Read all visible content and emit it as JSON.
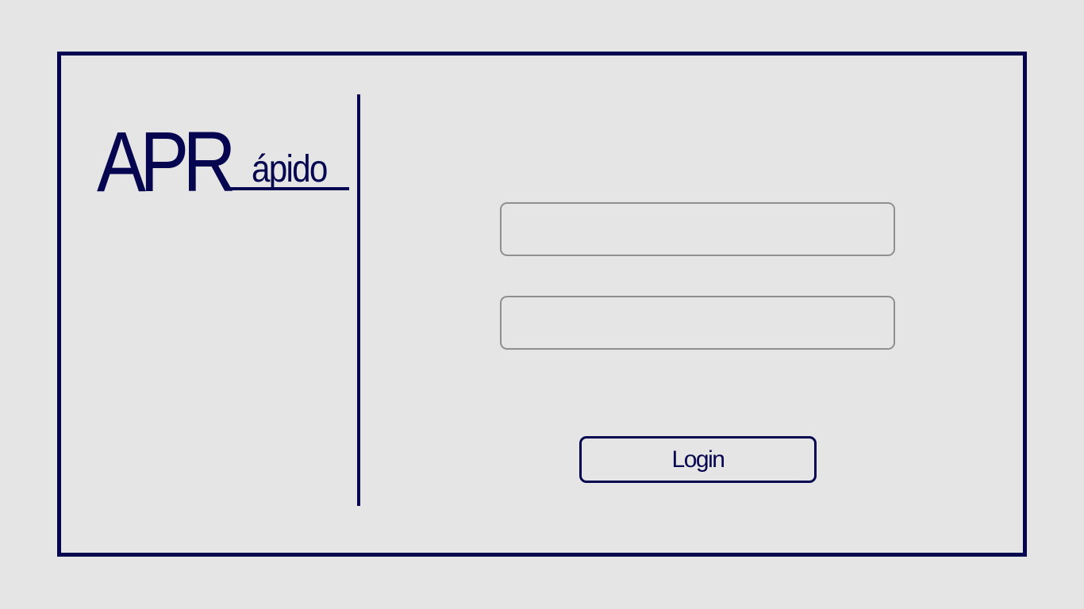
{
  "logo": {
    "primary": "APR",
    "secondary": "ápido"
  },
  "form": {
    "username_placeholder": "",
    "password_placeholder": "",
    "login_label": "Login"
  },
  "colors": {
    "brand": "#060650",
    "background": "#e5e5e5",
    "field_border": "#8f8f8f"
  }
}
